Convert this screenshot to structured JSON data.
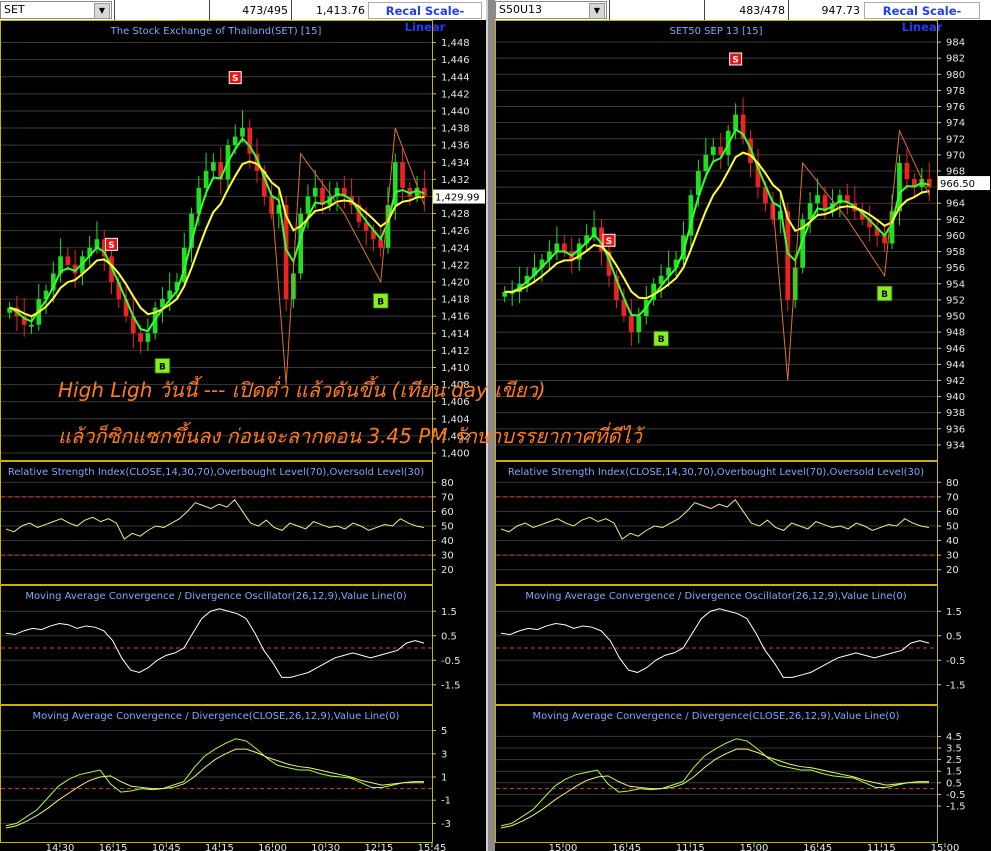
{
  "overlay": {
    "line1": "High Ligh วันนี้ --- เปิดต่ำ แล้วดันขึ้น (เทียน day เขียว)",
    "line2": "แล้วก็ซิกแซกขึ้นลง ก่อนจะลากตอน 3.45 PM รักษาบรรยากาศที่ดีไว้"
  },
  "left": {
    "symbol": "SET",
    "counter": "473/495",
    "price": "1,413.76",
    "recal_label": "Recal Scale-Linear",
    "main_title": "The Stock Exchange of Thailand(SET) [15]",
    "last_price_tag": "1,429.99",
    "price_ticks": [
      "1,448",
      "1,446",
      "1,444",
      "1,442",
      "1,440",
      "1,438",
      "1,436",
      "1,434",
      "1,432",
      "1,430",
      "1,428",
      "1,426",
      "1,424",
      "1,422",
      "1,420",
      "1,418",
      "1,416",
      "1,414",
      "1,412",
      "1,410",
      "1,408",
      "1,406",
      "1,404",
      "1,402",
      "1,400"
    ],
    "rsi_title": "Relative Strength Index(CLOSE,14,30,70),Overbought Level(70),Oversold Level(30)",
    "rsi_ticks": [
      "80",
      "70",
      "60",
      "50",
      "40",
      "30",
      "20"
    ],
    "macd_osc_title": "Moving Average Convergence / Divergence Oscillator(26,12,9),Value Line(0)",
    "macd_osc_ticks": [
      "1.5",
      "0.5",
      "-0.5",
      "-1.5"
    ],
    "macd_title": "Moving Average Convergence / Divergence(CLOSE,26,12,9),Value Line(0)",
    "macd_ticks": [
      "5",
      "3",
      "1",
      "-1",
      "-3"
    ],
    "time_labels": [
      "14:30",
      "16:15",
      "10:45",
      "14:15",
      "16:00",
      "10:30",
      "12:15",
      "15:45"
    ],
    "signals": [
      "S",
      "B",
      "S",
      "B"
    ]
  },
  "right": {
    "symbol": "S50U13",
    "counter": "483/478",
    "price": "947.73",
    "recal_label": "Recal Scale-Linear",
    "main_title": "SET50 SEP 13   [15]",
    "last_price_tag": "966.50",
    "price_ticks": [
      "984",
      "982",
      "980",
      "978",
      "976",
      "974",
      "972",
      "970",
      "968",
      "966",
      "964",
      "962",
      "960",
      "958",
      "956",
      "954",
      "952",
      "950",
      "948",
      "946",
      "944",
      "942",
      "940",
      "938",
      "936",
      "934"
    ],
    "rsi_title": "Relative Strength Index(CLOSE,14,30,70),Overbought Level(70),Oversold Level(30)",
    "rsi_ticks": [
      "80",
      "70",
      "60",
      "50",
      "40",
      "30",
      "20"
    ],
    "macd_osc_title": "Moving Average Convergence / Divergence Oscillator(26,12,9),Value Line(0)",
    "macd_osc_ticks": [
      "1.5",
      "0.5",
      "-0.5",
      "-1.5"
    ],
    "macd_title": "Moving Average Convergence / Divergence(CLOSE,26,12,9),Value Line(0)",
    "macd_ticks": [
      "4.5",
      "3.5",
      "2.5",
      "1.5",
      "0.5",
      "-0.5",
      "-1.5"
    ],
    "time_labels": [
      "15:00",
      "16:45",
      "11:15",
      "15:00",
      "16:45",
      "11:15",
      "15:00"
    ],
    "signals": [
      "S",
      "B",
      "S",
      "B"
    ]
  },
  "chart_data": [
    {
      "type": "candlestick",
      "panel": "left-price",
      "title": "The Stock Exchange of Thailand(SET) [15]",
      "ylim": [
        1400,
        1449
      ],
      "closes": [
        1417,
        1416,
        1415,
        1415,
        1418,
        1419,
        1421,
        1423,
        1422,
        1421,
        1423,
        1424,
        1425,
        1423,
        1420,
        1418,
        1416,
        1414,
        1413,
        1414,
        1417,
        1418,
        1419,
        1420,
        1424,
        1428,
        1431,
        1433,
        1434,
        1432,
        1436,
        1437,
        1438,
        1435,
        1433,
        1430,
        1428,
        1429,
        1418,
        1421,
        1428,
        1430,
        1431,
        1429,
        1430,
        1431,
        1430,
        1429,
        1427,
        1426,
        1425,
        1424,
        1429,
        1434,
        1431,
        1430,
        1431,
        1430
      ],
      "last": 1429.99,
      "signals": [
        {
          "label": "S",
          "type": "sell"
        },
        {
          "label": "B",
          "type": "buy"
        },
        {
          "label": "S",
          "type": "sell"
        },
        {
          "label": "B",
          "type": "buy"
        }
      ]
    },
    {
      "type": "candlestick",
      "panel": "right-price",
      "title": "SET50 SEP 13   [15]",
      "ylim": [
        933,
        985
      ],
      "closes": [
        953,
        953,
        954,
        955,
        956,
        957,
        958,
        959,
        958,
        957,
        959,
        960,
        961,
        958,
        955,
        952,
        950,
        948,
        950,
        952,
        954,
        955,
        956,
        957,
        960,
        965,
        968,
        970,
        971,
        970,
        973,
        975,
        972,
        969,
        966,
        964,
        962,
        963,
        952,
        956,
        962,
        964,
        965,
        963,
        964,
        965,
        964,
        963,
        962,
        961,
        960,
        959,
        963,
        969,
        967,
        966,
        967,
        966
      ],
      "last": 966.5,
      "signals": [
        {
          "label": "S",
          "type": "sell"
        },
        {
          "label": "B",
          "type": "buy"
        },
        {
          "label": "S",
          "type": "sell"
        },
        {
          "label": "B",
          "type": "buy"
        }
      ]
    },
    {
      "type": "line",
      "panel": "rsi",
      "title": "Relative Strength Index(CLOSE,14,30,70),Overbought Level(70),Oversold Level(30)",
      "ylim": [
        15,
        85
      ],
      "levels": [
        70,
        30
      ],
      "values": [
        48,
        46,
        50,
        52,
        49,
        51,
        53,
        55,
        52,
        50,
        54,
        56,
        53,
        55,
        52,
        41,
        45,
        43,
        47,
        50,
        49,
        52,
        55,
        60,
        66,
        64,
        62,
        65,
        63,
        68,
        60,
        52,
        50,
        54,
        49,
        47,
        52,
        50,
        48,
        53,
        51,
        49,
        50,
        48,
        52,
        50,
        47,
        49,
        51,
        50,
        55,
        52,
        50,
        49
      ]
    },
    {
      "type": "line",
      "panel": "macd-osc",
      "title": "Moving Average Convergence / Divergence Oscillator(26,12,9),Value Line(0)",
      "ylim": [
        -2,
        2
      ],
      "values": [
        0.6,
        0.55,
        0.7,
        0.8,
        0.75,
        0.9,
        1.0,
        0.95,
        0.8,
        0.9,
        0.85,
        0.7,
        0.3,
        -0.4,
        -0.9,
        -1.0,
        -0.8,
        -0.5,
        -0.3,
        -0.2,
        0.0,
        0.6,
        1.2,
        1.5,
        1.6,
        1.5,
        1.4,
        1.2,
        0.6,
        -0.1,
        -0.6,
        -1.2,
        -1.2,
        -1.1,
        -1.0,
        -0.8,
        -0.6,
        -0.4,
        -0.3,
        -0.2,
        -0.3,
        -0.4,
        -0.3,
        -0.2,
        -0.1,
        0.2,
        0.3,
        0.2
      ]
    },
    {
      "type": "line",
      "panel": "macd",
      "title": "Moving Average Convergence / Divergence(CLOSE,26,12,9),Value Line(0)",
      "ylim": [
        -4,
        6
      ],
      "series": [
        {
          "values": [
            -3.2,
            -3.0,
            -2.4,
            -1.8,
            -0.8,
            0.2,
            0.8,
            1.2,
            1.4,
            1.6,
            0.4,
            -0.3,
            -0.2,
            0.0,
            -0.1,
            0.0,
            0.3,
            0.6,
            1.8,
            2.8,
            3.4,
            3.9,
            4.3,
            4.1,
            3.4,
            2.6,
            2.0,
            1.8,
            1.6,
            1.6,
            1.3,
            1.1,
            1.0,
            0.9,
            0.5,
            0.1,
            0.1,
            0.3,
            0.5,
            0.5,
            0.5
          ]
        },
        {
          "values": [
            -3.4,
            -3.2,
            -2.8,
            -2.3,
            -1.7,
            -1.0,
            -0.4,
            0.2,
            0.7,
            1.0,
            1.1,
            0.6,
            0.2,
            0.1,
            0.0,
            0.0,
            0.1,
            0.4,
            1.0,
            1.8,
            2.5,
            3.0,
            3.4,
            3.4,
            3.1,
            2.7,
            2.4,
            2.1,
            1.9,
            1.8,
            1.6,
            1.4,
            1.2,
            1.0,
            0.7,
            0.5,
            0.3,
            0.4,
            0.5,
            0.6,
            0.6
          ]
        }
      ]
    }
  ]
}
